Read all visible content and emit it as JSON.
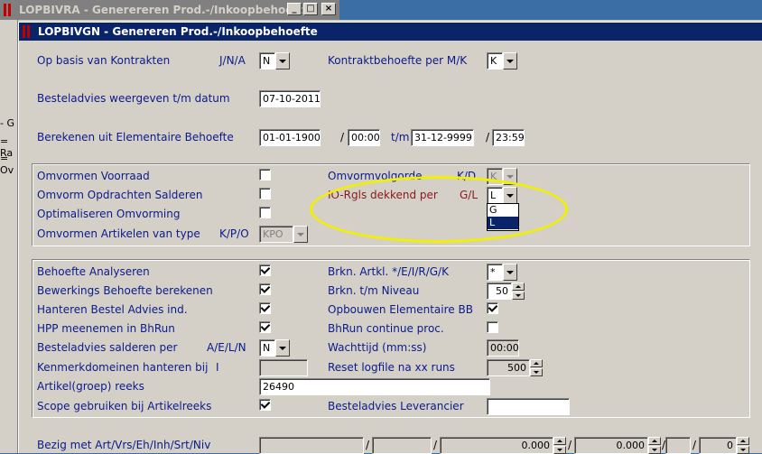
{
  "outer_window": {
    "title": "LOPBIVRA - Generereren Prod.-/Inkoopbehoefte",
    "minimize": "_",
    "maximize": "□",
    "close": "×"
  },
  "left_strip": [
    "- G",
    "= Ra",
    "= Ov"
  ],
  "inner_window": {
    "title": "LOPBIVGN - Genereren Prod.-/Inkoopbehoefte"
  },
  "top": {
    "op_basis_label": "Op basis van Kontrakten",
    "op_basis_codes": "J/N/A",
    "op_basis_value": "N",
    "kontrakt_label": "Kontraktbehoefte per M/K",
    "kontrakt_value": "K",
    "besteladvies_label": "Besteladvies weergeven t/m datum",
    "besteladvies_value": "07-10-2011",
    "berekenen_label": "Berekenen uit Elementaire Behoefte",
    "date_from": "01-01-1900",
    "time_from": "00:00",
    "tm_label": "t/m",
    "date_to": "31-12-9999",
    "time_to": "23:59",
    "slash": "/"
  },
  "group1": {
    "omvormen_voorraad_label": "Omvormen Voorraad",
    "omvormen_voorraad_checked": false,
    "omvorm_opdrachten_label": "Omvorm Opdrachten Salderen",
    "omvorm_opdrachten_checked": false,
    "optimaliseren_label": "Optimaliseren Omvorming",
    "optimaliseren_checked": false,
    "omvormen_artikelen_label": "Omvormen Artikelen van type",
    "omvormen_artikelen_codes": "K/P/O",
    "omvormen_artikelen_value": "KPO",
    "omvormvolgorde_label": "Omvormvolgorde",
    "omvormvolgorde_codes": "K/D",
    "omvormvolgorde_value": "K",
    "io_rgls_label": "IO-Rgls dekkend per",
    "io_rgls_codes": "G/L",
    "io_rgls_value": "L",
    "io_rgls_options": [
      "G",
      "L"
    ]
  },
  "group2": {
    "behoefte_analyseren_label": "Behoefte Analyseren",
    "behoefte_analyseren_checked": true,
    "bewerkings_label": "Bewerkings Behoefte berekenen",
    "bewerkings_checked": true,
    "hanteren_label": "Hanteren Bestel Advies ind.",
    "hanteren_checked": true,
    "hpp_label": "HPP meenemen in BhRun",
    "hpp_checked": true,
    "salderen_label": "Besteladvies salderen per",
    "salderen_codes": "A/E/L/N",
    "salderen_value": "N",
    "kenmerk_label": "Kenmerkdomeinen hanteren bij",
    "kenmerk_code": "I",
    "kenmerk_value": "",
    "artikel_label": "Artikel(groep) reeks",
    "artikel_value": "26490",
    "scope_label": "Scope gebruiken bij Artikelreeks",
    "scope_checked": true,
    "brkn_artkl_label": "Brkn. Artkl. */E/I/R/G/K",
    "brkn_artkl_value": "*",
    "brkn_niveau_label": "Brkn. t/m Niveau",
    "brkn_niveau_value": "50",
    "opbouwen_label": "Opbouwen Elementaire BB",
    "opbouwen_checked": true,
    "bhrun_label": "BhRun continue proc.",
    "bhrun_checked": false,
    "wachttijd_label": "Wachttijd (mm:ss)",
    "wachttijd_value": "00:00",
    "reset_label": "Reset logfile na xx runs",
    "reset_value": "500",
    "leverancier_label": "Besteladvies Leverancier",
    "leverancier_value": ""
  },
  "bottom": {
    "bezig_label": "Bezig met Art/Vrs/Eh/Inh/Srt/Niv",
    "field1": "",
    "field2": "",
    "value3": "0.000",
    "value4": "0.000",
    "field5": "",
    "value6": "0"
  },
  "colors": {
    "highlight": "#f0f000",
    "title_active": "#0a246a",
    "title_inactive": "#808080",
    "label": "#0a1a8a"
  }
}
